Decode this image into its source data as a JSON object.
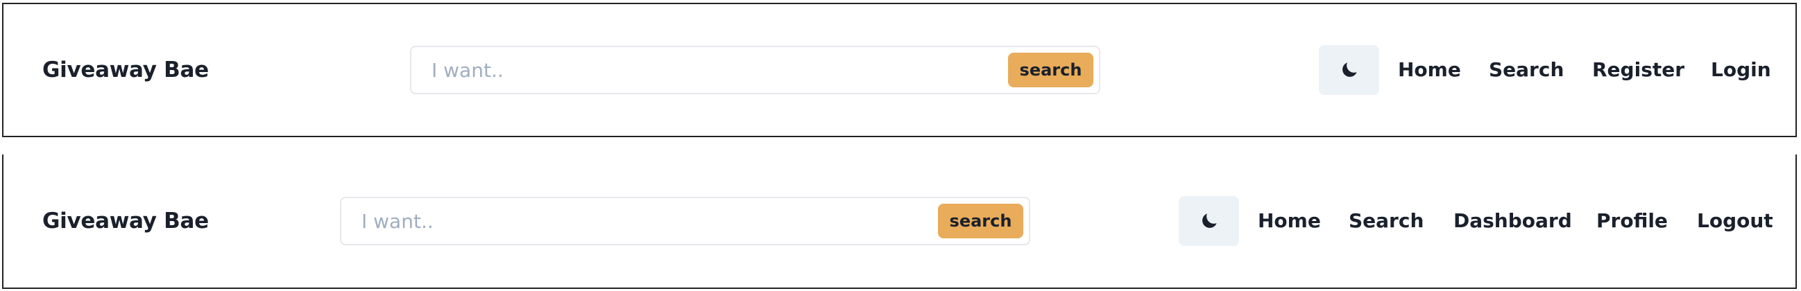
{
  "colors": {
    "accent": "#e8ac5a",
    "text": "#1a202c",
    "placeholder": "#a0aec0",
    "theme_button_bg": "#edf2f7"
  },
  "navbar_logged_out": {
    "brand": "Giveaway Bae",
    "search": {
      "placeholder": "I want..",
      "value": "",
      "button_label": "search"
    },
    "theme_toggle_icon": "moon-icon",
    "links": [
      "Home",
      "Search",
      "Register",
      "Login"
    ]
  },
  "navbar_logged_in": {
    "brand": "Giveaway Bae",
    "search": {
      "placeholder": "I want..",
      "value": "",
      "button_label": "search"
    },
    "theme_toggle_icon": "moon-icon",
    "links": [
      "Home",
      "Search",
      "Dashboard",
      "Profile",
      "Logout"
    ]
  }
}
